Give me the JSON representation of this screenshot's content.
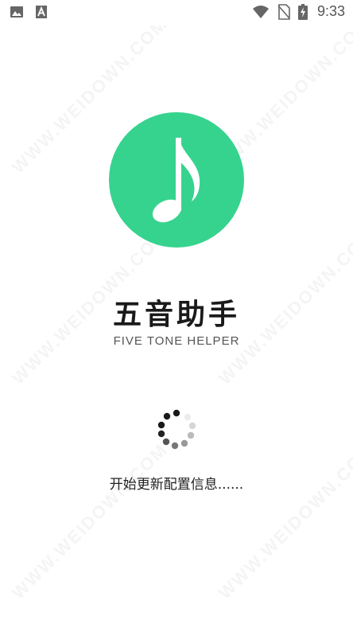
{
  "status_bar": {
    "time": "9:33",
    "left_icons": [
      "image-icon",
      "font-a-icon"
    ],
    "right_icons": [
      "wifi-icon",
      "no-sim-icon",
      "battery-charging-icon"
    ]
  },
  "app": {
    "title": "五音助手",
    "subtitle": "FIVE TONE HELPER",
    "logo_icon": "music-note-icon",
    "brand_color": "#36d38f"
  },
  "loading": {
    "text": "开始更新配置信息......"
  },
  "watermark": {
    "text": "WWW.WEIDOWN.COM"
  }
}
